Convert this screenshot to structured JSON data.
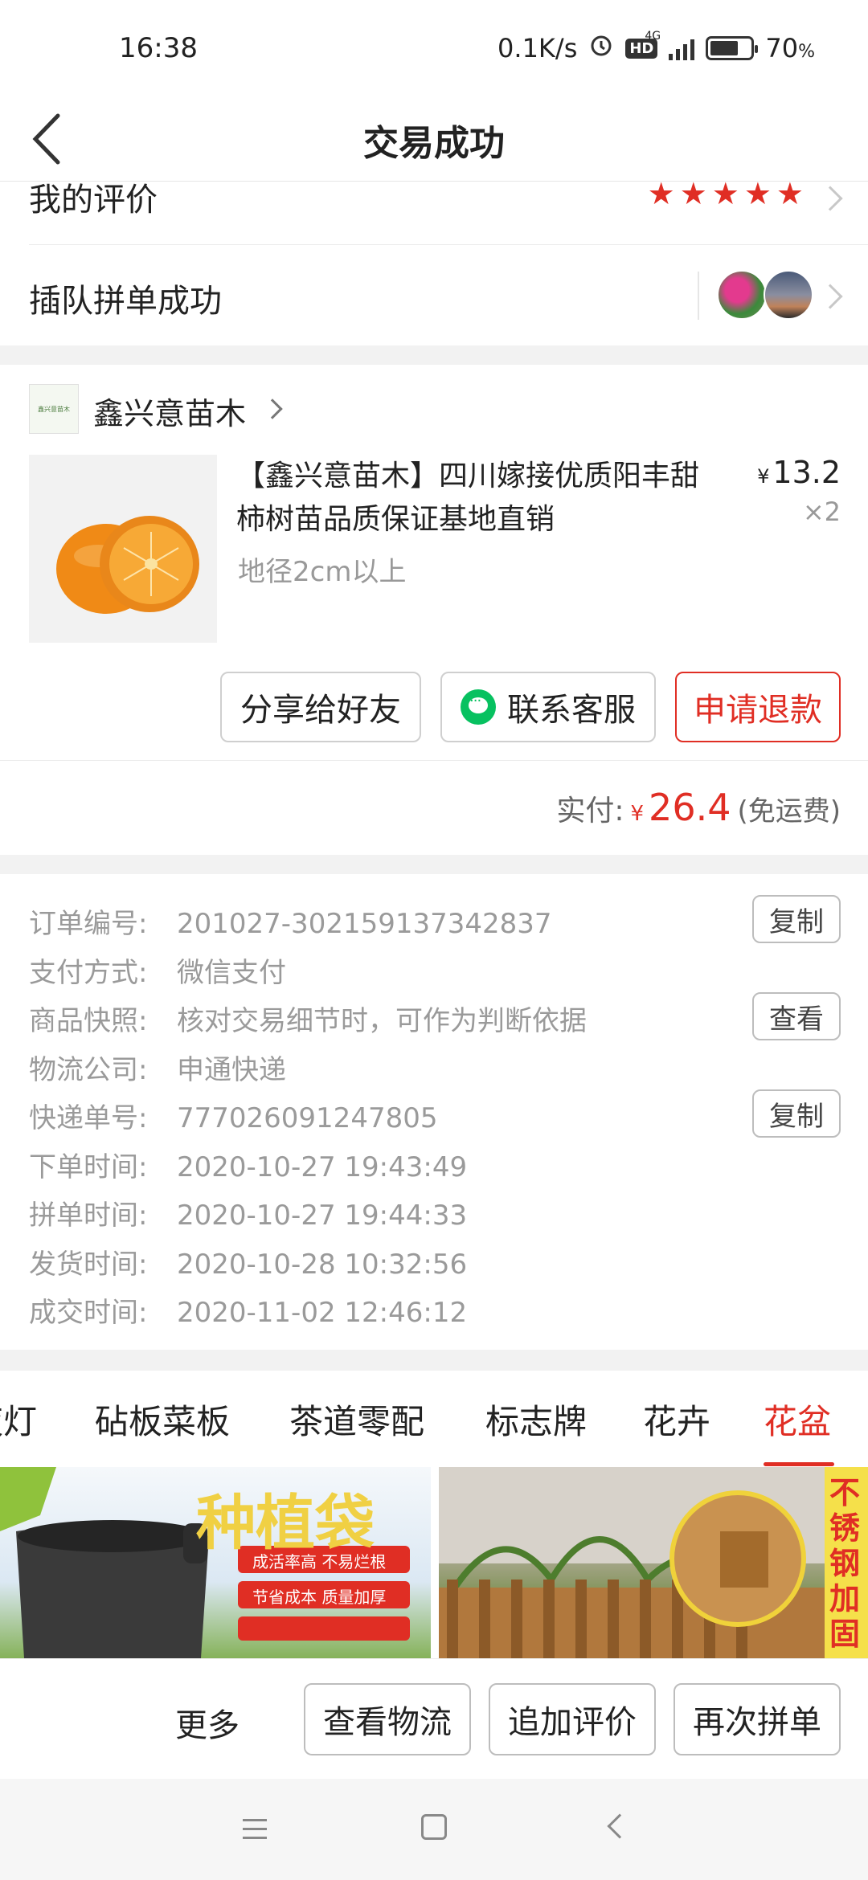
{
  "status_bar": {
    "time": "16:38",
    "net_speed": "0.1K/s",
    "hd": "HD",
    "network": "4G",
    "battery": "70",
    "battery_unit": "%",
    "battery_level": 0.7
  },
  "header": {
    "title": "交易成功"
  },
  "review": {
    "label": "我的评价",
    "stars": 5
  },
  "group": {
    "label": "插队拼单成功"
  },
  "shop": {
    "logo_text": "鑫兴意苗木",
    "name": "鑫兴意苗木"
  },
  "product": {
    "title": "【鑫兴意苗木】四川嫁接优质阳丰甜柿树苗品质保证基地直销",
    "spec": "地径2cm以上",
    "currency": "¥",
    "price": "13.2",
    "qty": "×2"
  },
  "actions": {
    "share": "分享给好友",
    "contact": "联系客服",
    "refund": "申请退款"
  },
  "payment": {
    "label": "实付:",
    "currency": "¥",
    "amount": "26.4",
    "shipping": "(免运费)"
  },
  "order_info": [
    {
      "key": "订单编号:",
      "value": "201027-302159137342837",
      "button": "复制"
    },
    {
      "key": "支付方式:",
      "value": "微信支付",
      "button": ""
    },
    {
      "key": "商品快照:",
      "value": "核对交易细节时，可作为判断依据",
      "button": "查看"
    },
    {
      "key": "物流公司:",
      "value": "申通快递",
      "button": ""
    },
    {
      "key": "快递单号:",
      "value": "777026091247805",
      "button": "复制"
    },
    {
      "key": "下单时间:",
      "value": "2020-10-27 19:43:49",
      "button": ""
    },
    {
      "key": "拼单时间:",
      "value": "2020-10-27 19:44:33",
      "button": ""
    },
    {
      "key": "发货时间:",
      "value": "2020-10-28 10:32:56",
      "button": ""
    },
    {
      "key": "成交时间:",
      "value": "2020-11-02 12:46:12",
      "button": ""
    }
  ],
  "categories": {
    "items": [
      "夜灯",
      "砧板菜板",
      "茶道零配",
      "标志牌",
      "花卉",
      "花盆"
    ],
    "active": "花盆"
  },
  "banners": {
    "left": {
      "title": "种植袋",
      "tags": [
        "成活率高",
        "不易烂根",
        "节省成本",
        "质量加厚"
      ]
    },
    "right": {
      "tag": "不锈钢加固"
    }
  },
  "bottom_bar": {
    "more": "更多",
    "logistics": "查看物流",
    "add_review": "追加评价",
    "reorder": "再次拼单"
  },
  "colors": {
    "accent": "#e02e24",
    "wechat": "#07c160"
  }
}
